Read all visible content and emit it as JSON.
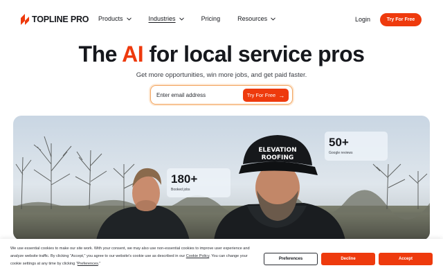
{
  "brand": {
    "name": "TOPLINE PRO",
    "accent_color": "#ee3a0d"
  },
  "nav": {
    "items": [
      {
        "label": "Products",
        "has_dropdown": true
      },
      {
        "label": "Industries",
        "has_dropdown": true
      },
      {
        "label": "Pricing",
        "has_dropdown": false
      },
      {
        "label": "Resources",
        "has_dropdown": true
      }
    ],
    "login_label": "Login",
    "cta_label": "Try For Free"
  },
  "hero": {
    "title_before": "The ",
    "title_accent": "AI",
    "title_after": " for local service pros",
    "subtitle": "Get more opportunities, win more jobs, and get paid faster.",
    "email_placeholder": "Enter email address",
    "cta_label": "Try For Free",
    "cta_icon": "arrow-right-icon"
  },
  "photo": {
    "cap_text_line1": "ELEVATION",
    "cap_text_line2": "ROOFING"
  },
  "stats": [
    {
      "value": "180+",
      "label": "Booked jobs"
    },
    {
      "value": "50+",
      "label": "Google reviews"
    }
  ],
  "cookie": {
    "text_part1": "We use essential cookies to make our site work. With your consent, we may also use non-essential cookies to improve user experience and analyze website traffic. By clicking “Accept,” you agree to our website's cookie use as described in our ",
    "policy_link": "Cookie Policy",
    "text_part2": ". You can change your cookie settings at any time by clicking “",
    "preferences_link": "Preferences",
    "text_part3": ".”",
    "preferences_label": "Preferences",
    "decline_label": "Decline",
    "accept_label": "Accept"
  }
}
